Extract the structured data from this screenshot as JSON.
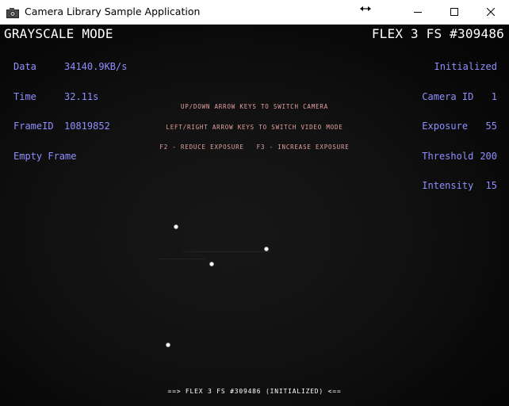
{
  "window": {
    "title": "Camera Library Sample Application"
  },
  "overlay": {
    "mode": "GRAYSCALE MODE",
    "camera_name": "FLEX 3 FS #309486",
    "left_stats": [
      {
        "key": "Data",
        "value": "34140.9KB/s"
      },
      {
        "key": "Time",
        "value": "32.11s"
      },
      {
        "key": "FrameID",
        "value": "10819852"
      },
      {
        "key": "Empty Frame",
        "value": ""
      }
    ],
    "status": "Initialized",
    "right_stats": [
      {
        "key": "Camera ID",
        "value": "1"
      },
      {
        "key": "Exposure",
        "value": "55"
      },
      {
        "key": "Threshold",
        "value": "200"
      },
      {
        "key": "Intensity",
        "value": "15"
      }
    ],
    "help_lines": [
      "UP/DOWN ARROW KEYS TO SWITCH CAMERA",
      "LEFT/RIGHT ARROW KEYS TO SWITCH VIDEO MODE",
      "F2 - REDUCE EXPOSURE   F3 - INCREASE EXPOSURE"
    ],
    "footer": "==> FLEX 3 FS #309486 (INITIALIZED) <=="
  },
  "colors": {
    "overlay_blue": "#8f8fff",
    "help_pink": "#e0a0a0",
    "background": "#000000"
  },
  "icons": {
    "app": "camera-app-icon",
    "resize": "horizontal-resize-arrow-icon",
    "minimize": "minimize-icon",
    "maximize": "maximize-icon",
    "close": "close-icon"
  }
}
